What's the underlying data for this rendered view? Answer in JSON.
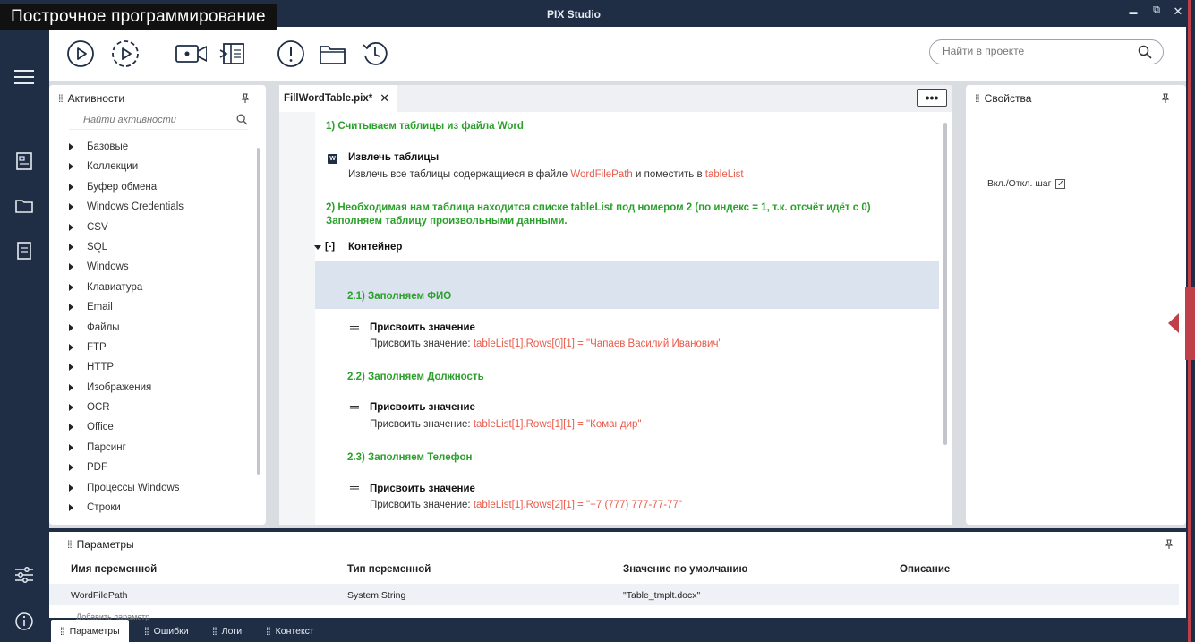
{
  "banner": "Построчное программирование",
  "app_title": "PIX Studio",
  "window_controls": {
    "minimize": "▬",
    "maximize": "⧉",
    "close": "✕"
  },
  "toolbar": {
    "buttons": [
      "play-icon",
      "step-run-icon",
      "record-video-icon",
      "panel-split-icon",
      "alert-icon",
      "folder-icon",
      "history-icon"
    ],
    "search_placeholder": "Найти в проекте"
  },
  "activities": {
    "title": "Активности",
    "search_placeholder": "Найти активности",
    "items": [
      "Базовые",
      "Коллекции",
      "Буфер обмена",
      "Windows Credentials",
      "CSV",
      "SQL",
      "Windows",
      "Клавиатура",
      "Email",
      "Файлы",
      "FTP",
      "HTTP",
      "Изображения",
      "OCR",
      "Office",
      "Парсинг",
      "PDF",
      "Процессы Windows",
      "Строки"
    ]
  },
  "workflow": {
    "tab_label": "FillWordTable.pix*",
    "tab_close": "✕",
    "more": "•••",
    "comment1": "1) Считываем таблицы из файла Word",
    "extract_title": "Извлечь таблицы",
    "extract_desc_a": "Извлечь все таблицы содержащиеся в файле ",
    "extract_var1": "WordFilePath",
    "extract_desc_b": " и поместить в ",
    "extract_var2": "tableList",
    "comment2_line1": "2) Необходимая нам таблица находится списке tableList под номером 2 (по индекс = 1, т.к. отсчёт идёт с 0)",
    "comment2_line2": "Заполняем таблицу произвольными данными.",
    "container_label": "Контейнер",
    "container_toggle": "[-]",
    "sub1": "2.1) Заполняем ФИО",
    "assign1_title": "Присвоить значение",
    "assign1_prefix": "Присвоить значение: ",
    "assign1_expr": "tableList[1].Rows[0][1] = \"Чапаев Василий Иванович\"",
    "sub2": "2.2) Заполняем Должность",
    "assign2_title": "Присвоить значение",
    "assign2_prefix": "Присвоить значение: ",
    "assign2_expr": "tableList[1].Rows[1][1] = \"Командир\"",
    "sub3": "2.3) Заполняем Телефон",
    "assign3_title": "Присвоить значение",
    "assign3_prefix": "Присвоить значение: ",
    "assign3_expr": "tableList[1].Rows[2][1] = \"+7 (777) 777-77-77\""
  },
  "properties": {
    "title": "Свойства",
    "toggle_label": "Вкл./Откл. шаг",
    "toggle_checked": "✓"
  },
  "parameters": {
    "title": "Параметры",
    "columns": [
      "Имя переменной",
      "Тип переменной",
      "Значение по умолчанию",
      "Описание"
    ],
    "rows": [
      {
        "name": "WordFilePath",
        "type": "System.String",
        "default": "\"Table_tmplt.docx\"",
        "desc": ""
      }
    ],
    "cut_text": "Добавить параметр"
  },
  "bottom_tabs": [
    "Параметры",
    "Ошибки",
    "Логи",
    "Контекст"
  ]
}
